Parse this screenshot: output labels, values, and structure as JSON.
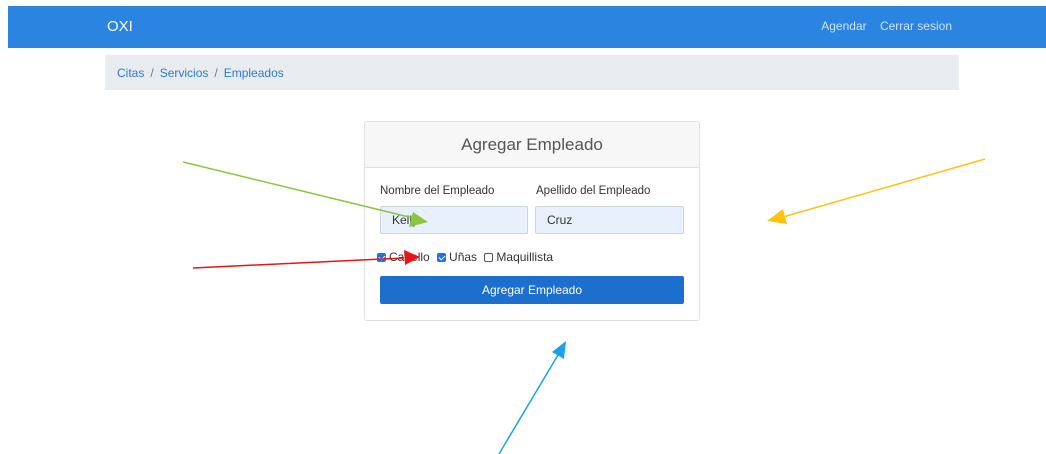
{
  "navbar": {
    "brand": "OXI",
    "links": [
      "Agendar",
      "Cerrar sesion"
    ],
    "color": "#2a84e0"
  },
  "breadcrumb": [
    "Citas",
    "Servicios",
    "Empleados"
  ],
  "form": {
    "title": "Agregar Empleado",
    "first_name_label": "Nombre del Empleado",
    "first_name_value": "Kelly",
    "last_name_label": "Apellido del Empleado",
    "last_name_value": "Cruz",
    "checkboxes": [
      {
        "label": "Cabello",
        "checked": true
      },
      {
        "label": "Uñas",
        "checked": true
      },
      {
        "label": "Maquillista",
        "checked": false
      }
    ],
    "submit_label": "Agregar Empleado"
  },
  "annotation_arrow_colors": [
    "#8cc63f",
    "#ffc20e",
    "#e8141b",
    "#1aa3e6"
  ]
}
